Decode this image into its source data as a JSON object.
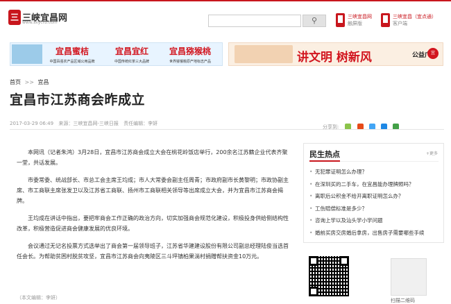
{
  "logo": {
    "mark": "三",
    "text": "三峡宜昌网",
    "url": "www.sxycrb.com"
  },
  "search": {
    "placeholder": "",
    "icon": "search-icon"
  },
  "apps": [
    {
      "name": "三峡宜昌网",
      "sub": "触屏版"
    },
    {
      "name": "三峡宜昌（宜点通）",
      "sub": "客户端"
    }
  ],
  "banner_left": {
    "products": [
      {
        "title": "宜昌蜜桔",
        "sub": "中国百强农产品区域公用品牌"
      },
      {
        "title": "宜昌宜红",
        "sub": "中国传统红茶三大品牌"
      },
      {
        "title": "宜昌猕猴桃",
        "sub": "世界猕猴桃原产地标志产品"
      }
    ]
  },
  "banner_right": {
    "slogan": "讲文明 树新风",
    "ad": "公益广告",
    "mark": "宜"
  },
  "breadcrumb": {
    "home": "首页",
    "sep": ">>",
    "section": "宜昌"
  },
  "article": {
    "title": "宜昌市江苏商会昨成立",
    "date": "2017-03-29 06:49",
    "source": "来源：三峡宜昌网-三峡日报",
    "editor": "责任编辑：李妍",
    "share_label": "分享到:",
    "paragraphs": [
      "本网讯（记者朱鸿）3月28日，宜昌市江苏商会成立大会在桃花岭饭店举行，200余名江苏籍企业代表齐聚一堂，共话发展。",
      "市委常委、统战部长、市总工会主席王均成；市人大常委会副主任周青；市政府副市长黄黎明；市政协副主席、市工商联主席张发卫以及江苏省工商联、扬州市工商联相关领导等出席成立大会，并为宜昌市江苏商会揭牌。",
      "王均成在讲话中指出，要把牢商会工作正确的政治方向，切实加强商会规范化建设，积极投身供给侧结构性改革，积极营造促进商会健康发展的优良环境。",
      "会议通过无记名投票方式选举出了商会第一届领导班子，江苏省华建建设股份有限公司副总经理陆俊当选首任会长。为帮助贫困村脱贫攻坚，宜昌市江苏商会向夷陵区三斗坪镇柏果淌村捐赠帮扶资金10万元。"
    ],
    "bottom_hint": "（本文编辑：李妍）"
  },
  "sidebar": {
    "title": "民生热点",
    "more": "+更多",
    "items": [
      "无犯罪证明怎么办理？",
      "在深圳买的二手车，在宜昌能办理牌照吗？",
      "离职后公积金不给开离职证明怎么办？",
      "工伤赔偿标准是多少？",
      "咨询上学以及汕头学小学问题",
      "婚前买房交房婚后拿房，出售房子需要哪些手续"
    ],
    "qr_caption": "扫描二维码"
  },
  "colors": {
    "brand": "#c8161d",
    "text": "#333333",
    "meta": "#999999"
  }
}
